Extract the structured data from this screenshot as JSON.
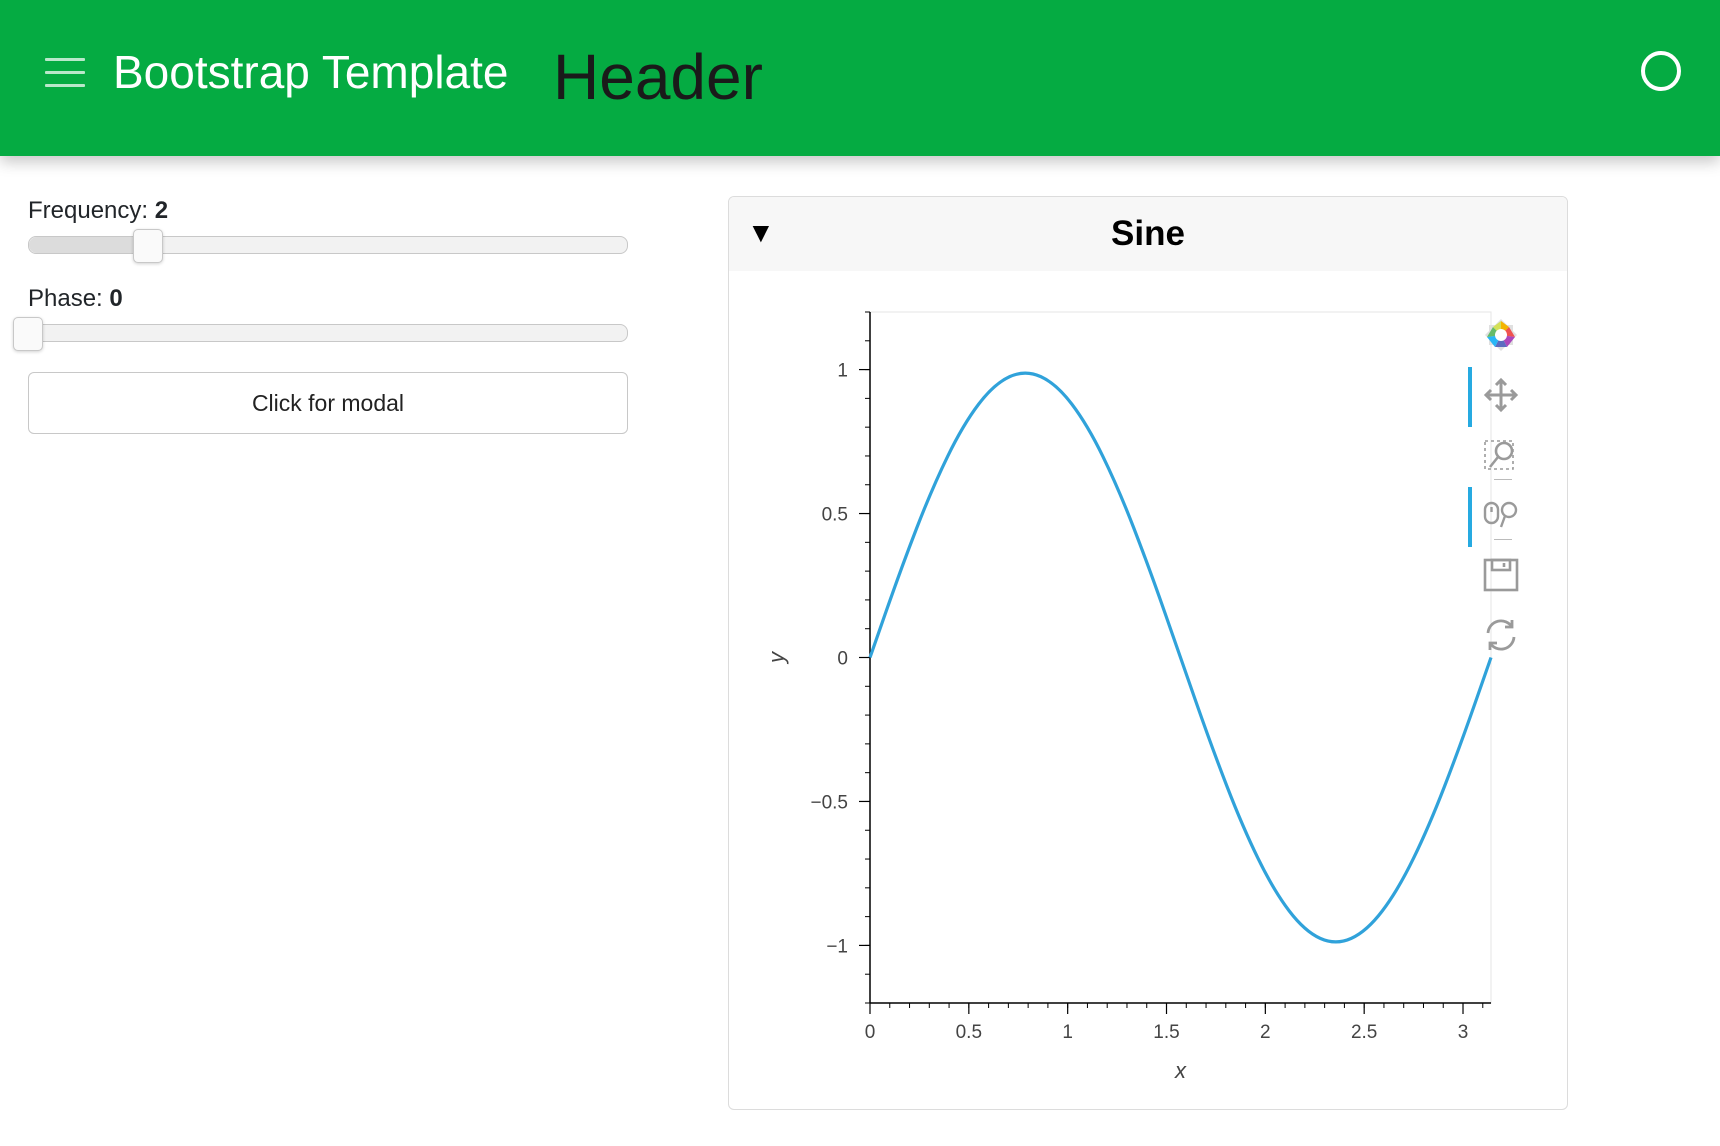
{
  "header": {
    "menu_icon": "hamburger-menu-icon",
    "site_title": "Bootstrap Template",
    "page_title": "Header",
    "busy_indicator_icon": "circle-icon",
    "color": "#05ab42"
  },
  "sidebar": {
    "frequency": {
      "label": "Frequency: ",
      "value": "2",
      "min": 0,
      "max": 10,
      "current": 2
    },
    "phase": {
      "label": "Phase: ",
      "value": "0",
      "min": 0,
      "max": 3.14,
      "current": 0
    },
    "modal_button": "Click for modal"
  },
  "card": {
    "collapse_icon": "▼",
    "title": "Sine"
  },
  "toolbar": {
    "tools": [
      "bokeh-logo-icon",
      "pan-icon",
      "box-zoom-icon",
      "wheel-zoom-icon",
      "save-icon",
      "reset-icon"
    ],
    "active": [
      "pan-icon",
      "wheel-zoom-icon"
    ]
  },
  "chart_data": {
    "type": "line",
    "xlabel": "x",
    "ylabel": "y",
    "xlim": [
      0,
      3.1416
    ],
    "ylim": [
      -1.2,
      1.2
    ],
    "x_ticks": [
      0,
      0.5,
      1,
      1.5,
      2,
      2.5,
      3
    ],
    "x_tick_labels": [
      "0",
      "0.5",
      "1",
      "1.5",
      "2",
      "2.5",
      "3"
    ],
    "y_ticks": [
      -1,
      -0.5,
      0,
      0.5,
      1
    ],
    "y_tick_labels": [
      "−1",
      "−0.5",
      "0",
      "0.5",
      "1"
    ],
    "series": [
      {
        "color": "#30a2da",
        "x": [
          0,
          0.1571,
          0.3142,
          0.4712,
          0.6283,
          0.7854,
          0.9425,
          1.0996,
          1.2566,
          1.4137,
          1.5708,
          1.7279,
          1.885,
          2.042,
          2.1991,
          2.3562,
          2.5133,
          2.6704,
          2.8274,
          2.9845,
          3.1416
        ],
        "y": [
          0,
          0.309,
          0.588,
          0.809,
          0.951,
          1.0,
          0.951,
          0.809,
          0.588,
          0.309,
          0,
          -0.309,
          -0.588,
          -0.809,
          -0.951,
          -1.0,
          -0.951,
          -0.809,
          -0.588,
          -0.309,
          0
        ]
      }
    ]
  }
}
